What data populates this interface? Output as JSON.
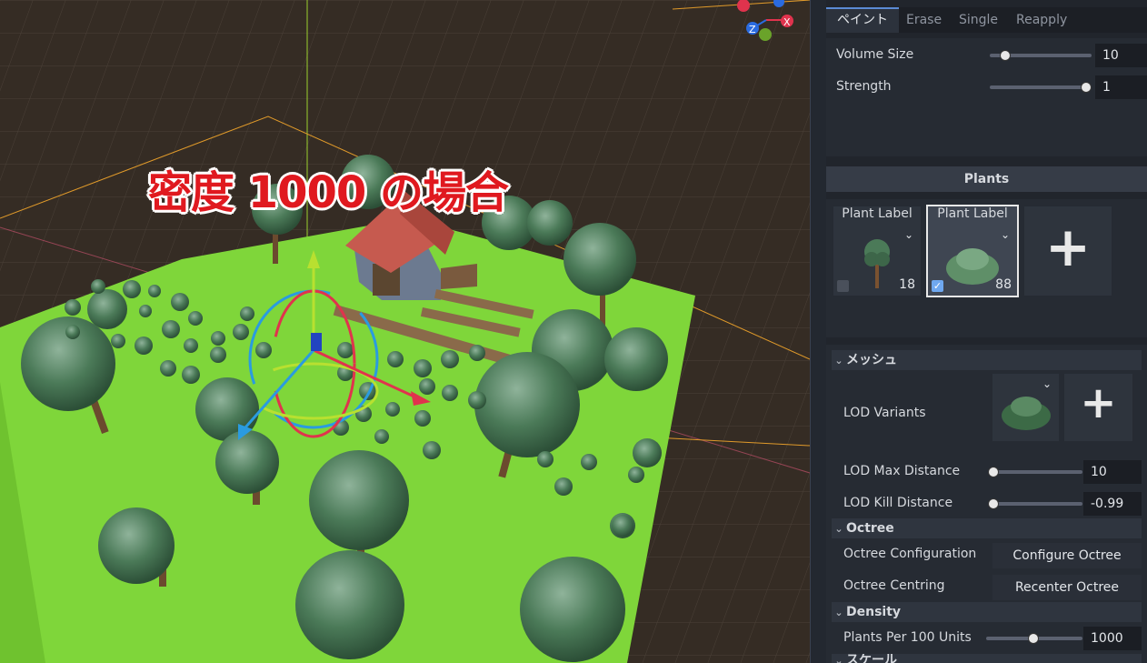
{
  "viewport": {
    "caption": "密度 1000 の場合",
    "gizmo_axis_x": "X"
  },
  "panel": {
    "tabs": [
      "ペイント",
      "Erase",
      "Single",
      "Reapply"
    ],
    "brush": {
      "volume_size_label": "Volume Size",
      "volume_size_value": "10",
      "strength_label": "Strength",
      "strength_value": "1"
    },
    "plants_header": "Plants",
    "plants": [
      {
        "label": "Plant Label",
        "count": "18",
        "checked": false,
        "icon": "tree-icon"
      },
      {
        "label": "Plant Label",
        "count": "88",
        "checked": true,
        "icon": "bush-icon"
      }
    ],
    "add_plant_icon": "plus-icon",
    "mesh_group": "メッシュ",
    "lod_variants_label": "LOD Variants",
    "lod_max_distance_label": "LOD Max Distance",
    "lod_max_distance_value": "10",
    "lod_kill_distance_label": "LOD Kill Distance",
    "lod_kill_distance_value": "-0.99",
    "octree_group": "Octree",
    "octree_config_label": "Octree Configuration",
    "octree_config_button": "Configure Octree",
    "octree_centring_label": "Octree Centring",
    "octree_centring_button": "Recenter Octree",
    "density_group": "Density",
    "plants_per_label": "Plants Per 100 Units",
    "plants_per_value": "1000",
    "scale_group": "スケール"
  },
  "colors": {
    "ground": "#7fd63a",
    "tree_foliage": "#3f6e4c",
    "accent_blue": "#5b8bd4"
  }
}
